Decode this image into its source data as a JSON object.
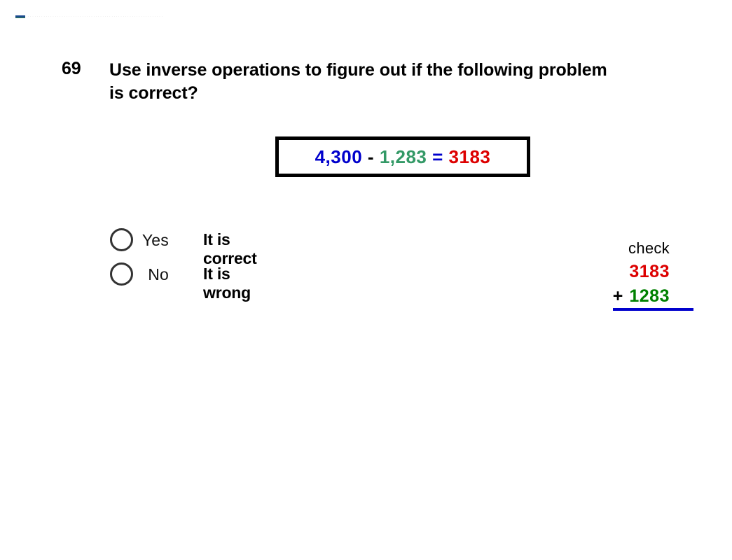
{
  "header": {
    "strip_text": "· · · · · · · · · · · · · · · · · · · · · · · · · · · · · · · · · · · · · · · · · · · · · · · · · · · · · · · · · · · ·",
    "rule_icon": "mini-rule-icon"
  },
  "question": {
    "number": "69",
    "text": "Use inverse operations to figure out if the following problem is correct?"
  },
  "equation": {
    "minuend": "4,300",
    "operator": "-",
    "subtrahend": "1,283",
    "equals": "=",
    "result": "3183",
    "colors": {
      "minuend": "#0000CC",
      "operator": "#000000",
      "subtrahend": "#339966",
      "equals": "#0000CC",
      "result": "#DD0000"
    }
  },
  "options": [
    {
      "key": "Yes",
      "description": "It is correct",
      "selected": false
    },
    {
      "key": "No",
      "description": "It is wrong",
      "selected": false
    }
  ],
  "check_work": {
    "label": "check",
    "top_number": "3183",
    "plus_sign": "+",
    "addend": "1283",
    "colors": {
      "top_number": "#DD0000",
      "addend": "#008000",
      "rule": "#0000CC"
    }
  }
}
